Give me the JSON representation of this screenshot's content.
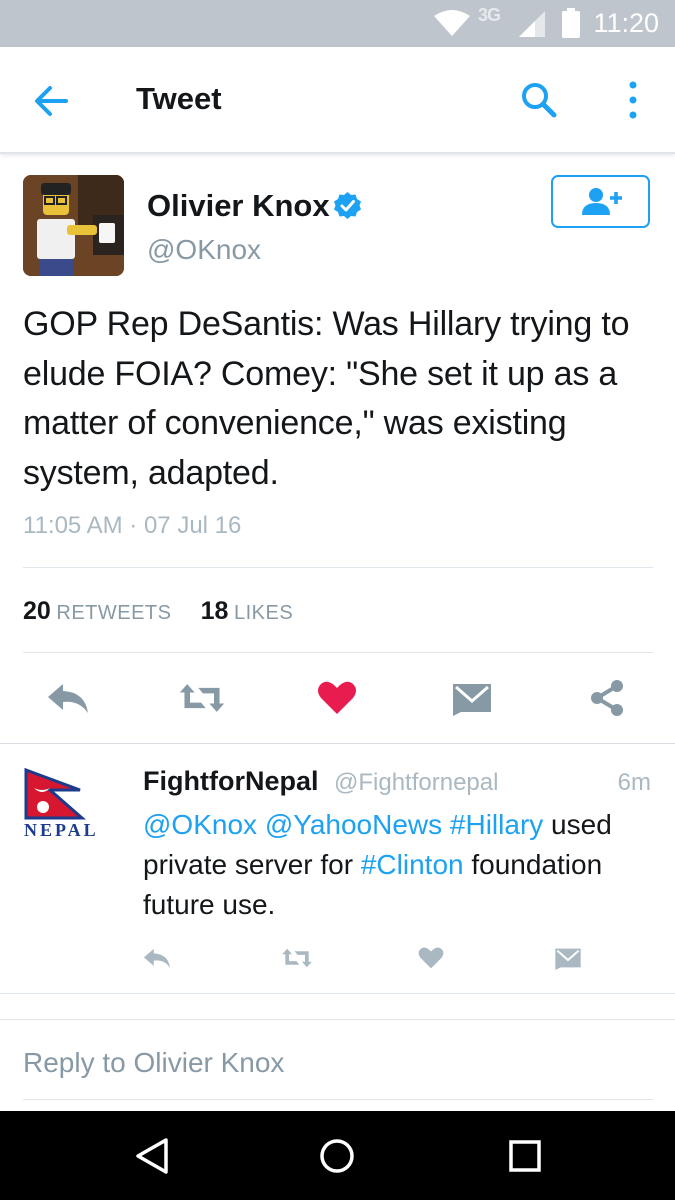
{
  "status_bar": {
    "time": "11:20",
    "network": "3G"
  },
  "app_bar": {
    "title": "Tweet"
  },
  "tweet": {
    "author_name": "Olivier Knox",
    "author_handle": "@OKnox",
    "text": "GOP Rep DeSantis: Was Hillary trying to elude FOIA? Comey: \"She set it up as a matter of convenience,\" was existing system, adapted.",
    "timestamp": "11:05 AM · 07 Jul 16",
    "retweets_count": "20",
    "retweets_label": "RETWEETS",
    "likes_count": "18",
    "likes_label": "LIKES"
  },
  "reply": {
    "author_name": "FightforNepal",
    "author_handle": "@Fightfornepal",
    "time": "6m",
    "avatar_text": "NEPAL",
    "mention1": "@OKnox",
    "mention2": "@YahooNews",
    "hashtag1": "#Hillary",
    "text1": " used private server for ",
    "hashtag2": "#Clinton",
    "text2": " foundation future use."
  },
  "reply_box": {
    "placeholder": "Reply to Olivier Knox"
  },
  "colors": {
    "accent": "#1da1f2",
    "like": "#e81c4f",
    "icon_gray": "#8899a6"
  }
}
